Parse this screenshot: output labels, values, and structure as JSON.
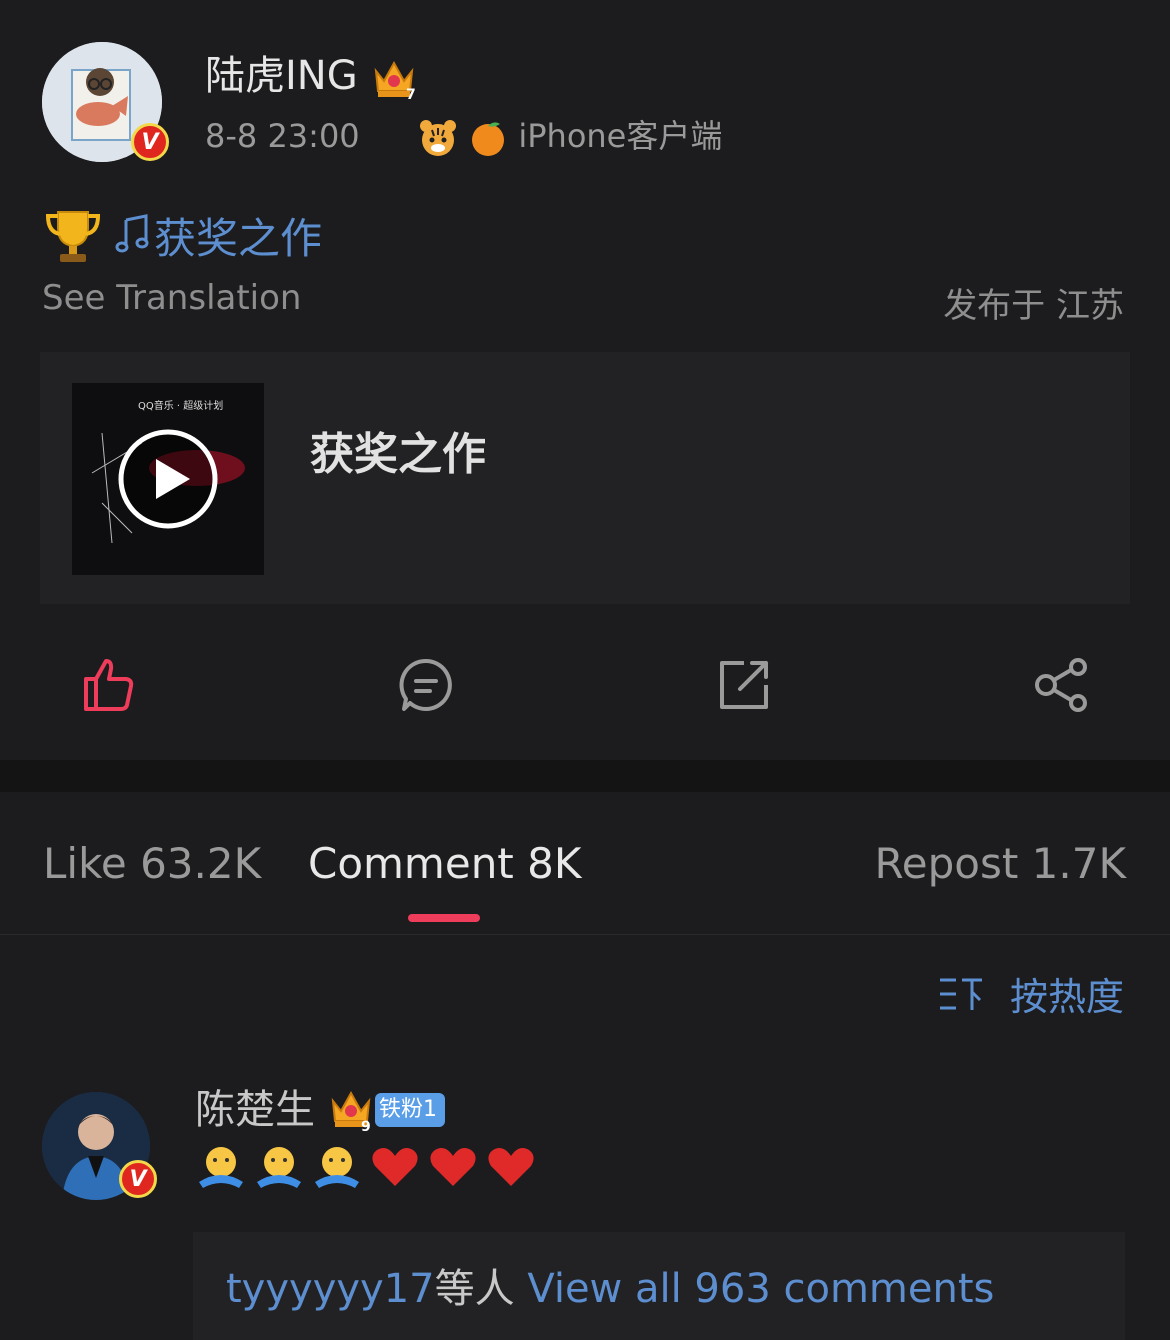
{
  "post": {
    "author": "陆虎ING",
    "time": "8-8 23:00",
    "source": "iPhone客户端",
    "topic": "获奖之作",
    "see_translation": "See Translation",
    "location": "发布于 江苏"
  },
  "card": {
    "title": "获奖之作",
    "cover_brand": "QQ音乐 · 超级计划"
  },
  "actions": [
    {
      "icon": "thumbs-up-icon",
      "active": true
    },
    {
      "icon": "comment-icon"
    },
    {
      "icon": "repost-icon"
    },
    {
      "icon": "share-icon"
    }
  ],
  "tabs": {
    "like": "Like 63.2K",
    "comment": "Comment 8K",
    "repost": "Repost 1.7K"
  },
  "sort": {
    "label": "按热度"
  },
  "comment": {
    "author": "陈楚生",
    "badge_level": "9",
    "fan_badge": "铁粉1",
    "content_emojis": [
      "hug-emoji",
      "hug-emoji",
      "hug-emoji",
      "heart-emoji",
      "heart-emoji",
      "heart-emoji"
    ]
  },
  "replies": {
    "user": "tyyyyyy17",
    "middle": "等人",
    "link": "View all 963 comments"
  },
  "colors": {
    "background": "#1c1c1e",
    "link": "#5d8fd0",
    "accent": "#ee3c5b"
  }
}
